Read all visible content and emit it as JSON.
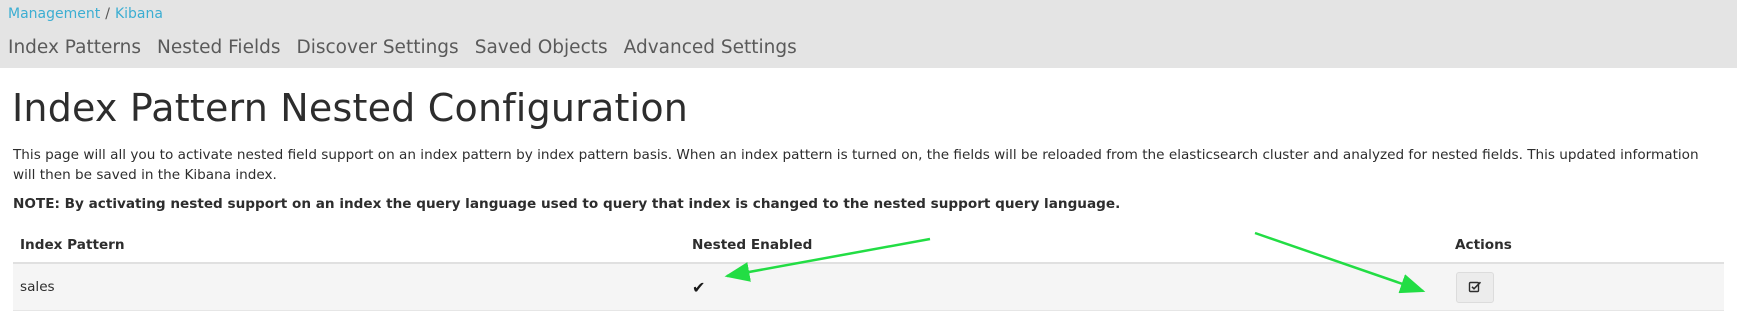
{
  "breadcrumb": {
    "items": [
      "Management",
      "Kibana"
    ],
    "separator": "/"
  },
  "tabs": [
    "Index Patterns",
    "Nested Fields",
    "Discover Settings",
    "Saved Objects",
    "Advanced Settings"
  ],
  "page": {
    "title": "Index Pattern Nested Configuration",
    "description": "This page will all you to activate nested field support on an index pattern by index pattern basis. When an index pattern is turned on, the fields will be reloaded from the elasticsearch cluster and analyzed for nested fields. This updated information will then be saved in the Kibana index.",
    "note": "NOTE: By activating nested support on an index the query language used to query that index is changed to the nested support query language."
  },
  "table": {
    "headers": [
      "Index Pattern",
      "Nested Enabled",
      "Actions"
    ],
    "rows": [
      {
        "index_pattern": "sales",
        "nested_enabled_icon": "✔",
        "action_icon": "edit-checkbox-icon"
      }
    ]
  },
  "colors": {
    "link": "#3caed2",
    "annotation_arrow": "#22dd44",
    "topbar": "#e4e4e4"
  }
}
